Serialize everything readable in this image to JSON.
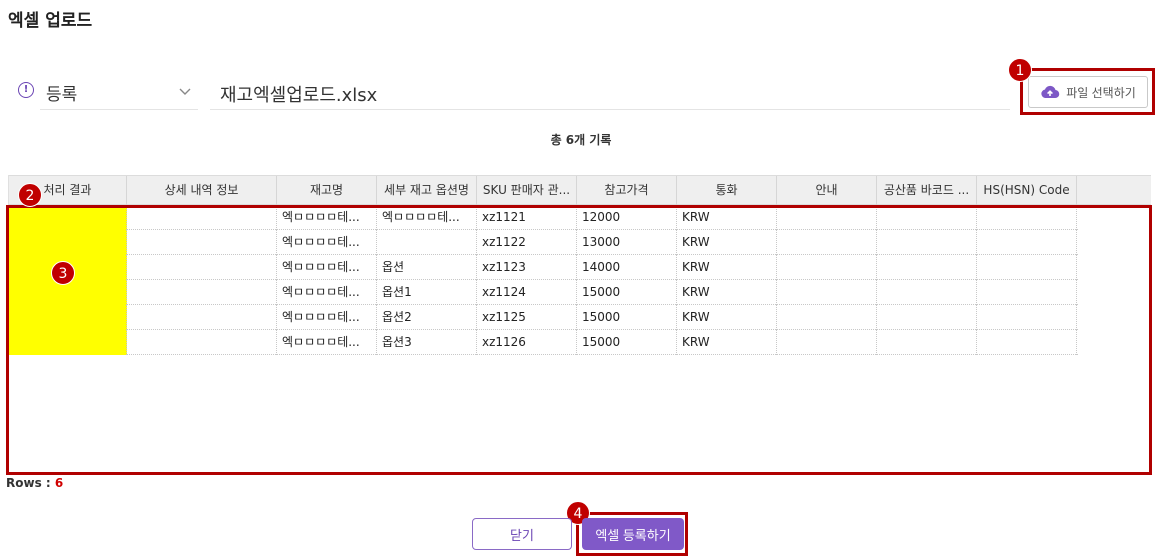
{
  "title": "엑셀 업로드",
  "mode": {
    "selected": "등록"
  },
  "file": {
    "name": "재고엑셀업로드.xlsx",
    "button_label": "파일 선택하기"
  },
  "records_text": "총 6개 기록",
  "columns": [
    "처리 결과",
    "상세 내역 정보",
    "재고명",
    "세부 재고 옵션명",
    "SKU 판매자 관...",
    "참고가격",
    "통화",
    "안내",
    "공산품 바코드 ...",
    "HS(HSN) Code"
  ],
  "rows": [
    [
      "",
      "",
      "엑ㅁㅁㅁㅁ테...",
      "엑ㅁㅁㅁㅁ테...",
      "xz1121",
      "12000",
      "KRW",
      "",
      "",
      ""
    ],
    [
      "",
      "",
      "엑ㅁㅁㅁㅁ테...",
      "",
      "xz1122",
      "13000",
      "KRW",
      "",
      "",
      ""
    ],
    [
      "",
      "",
      "엑ㅁㅁㅁㅁ테...",
      "옵션",
      "xz1123",
      "14000",
      "KRW",
      "",
      "",
      ""
    ],
    [
      "",
      "",
      "엑ㅁㅁㅁㅁ테...",
      "옵션1",
      "xz1124",
      "15000",
      "KRW",
      "",
      "",
      ""
    ],
    [
      "",
      "",
      "엑ㅁㅁㅁㅁ테...",
      "옵션2",
      "xz1125",
      "15000",
      "KRW",
      "",
      "",
      ""
    ],
    [
      "",
      "",
      "엑ㅁㅁㅁㅁ테...",
      "옵션3",
      "xz1126",
      "15000",
      "KRW",
      "",
      "",
      ""
    ]
  ],
  "footer": {
    "rows_label": "Rows : ",
    "rows_count": "6"
  },
  "buttons": {
    "close": "닫기",
    "submit": "엑셀 등록하기"
  },
  "annotations": [
    "1",
    "2",
    "3",
    "4"
  ],
  "icons": {
    "info": "info-circle-icon",
    "dropdown": "chevron-down-icon",
    "upload": "cloud-upload-icon"
  },
  "colors": {
    "accent": "#8059c8",
    "highlight_box": "#b00000",
    "badge": "#c00000",
    "result_fill": "#ffff00"
  }
}
